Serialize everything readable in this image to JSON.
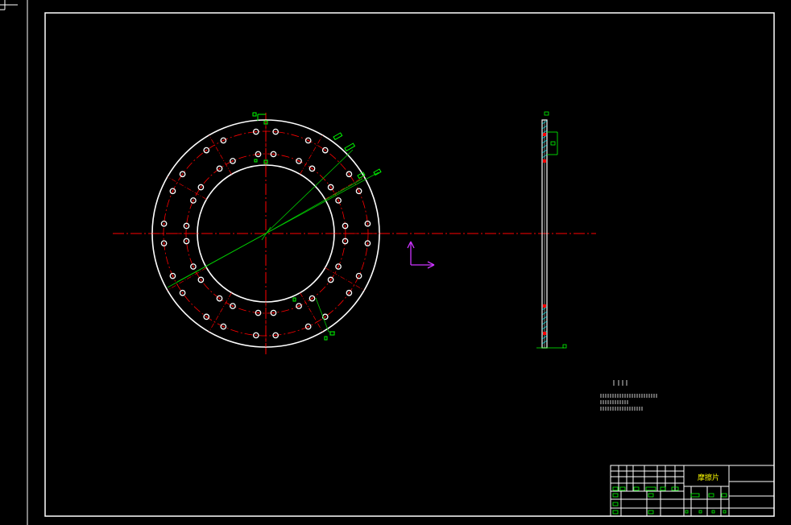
{
  "title_block": {
    "part_name": "摩擦片"
  },
  "colors": {
    "background": "#000000",
    "frame": "#ffffff",
    "outline": "#ffffff",
    "centerline": "#ff0000",
    "dimension": "#00ff00",
    "ucs_icon": "#cc33ff",
    "title_text": "#ffff00"
  },
  "icons": {
    "ucs": "ucs-axis-icon"
  }
}
